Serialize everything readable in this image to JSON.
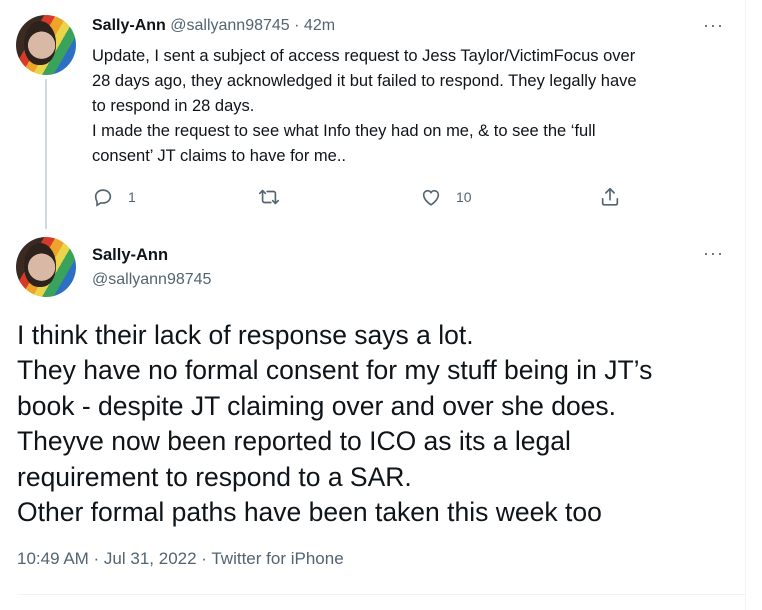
{
  "tweet1": {
    "name": "Sally-Ann",
    "handle": "@sallyann98745",
    "separator": "·",
    "time": "42m",
    "more": "···",
    "lines": [
      "Update, I sent a subject of access request to Jess Taylor/VictimFocus over",
      "28 days ago, they acknowledged it but failed to respond. They legally have",
      "to respond in 28 days.",
      "I made the request to see what Info they had on me, & to see the ‘full",
      "consent’ JT claims to have for me.."
    ],
    "reply_count": "1",
    "retweet_count": "",
    "like_count": "10",
    "icons": [
      "reply-icon",
      "retweet-icon",
      "like-icon",
      "share-icon"
    ]
  },
  "tweet2": {
    "name": "Sally-Ann",
    "handle": "@sallyann98745",
    "more": "···",
    "lines": [
      "I think their lack of response says a lot.",
      "They have no formal consent for my stuff being in JT’s",
      "book - despite JT claiming over and over she does.",
      "Theyve now been reported to ICO as its a legal",
      "requirement to respond to a SAR.",
      "Other formal paths have been taken this week too"
    ],
    "timestamp": "10:49 AM · Jul 31, 2022 · Twitter for iPhone"
  },
  "colors": {
    "text": "#0f1419",
    "secondary": "#536471",
    "thread_line": "#cfd9de",
    "divider": "#eff3f4"
  }
}
